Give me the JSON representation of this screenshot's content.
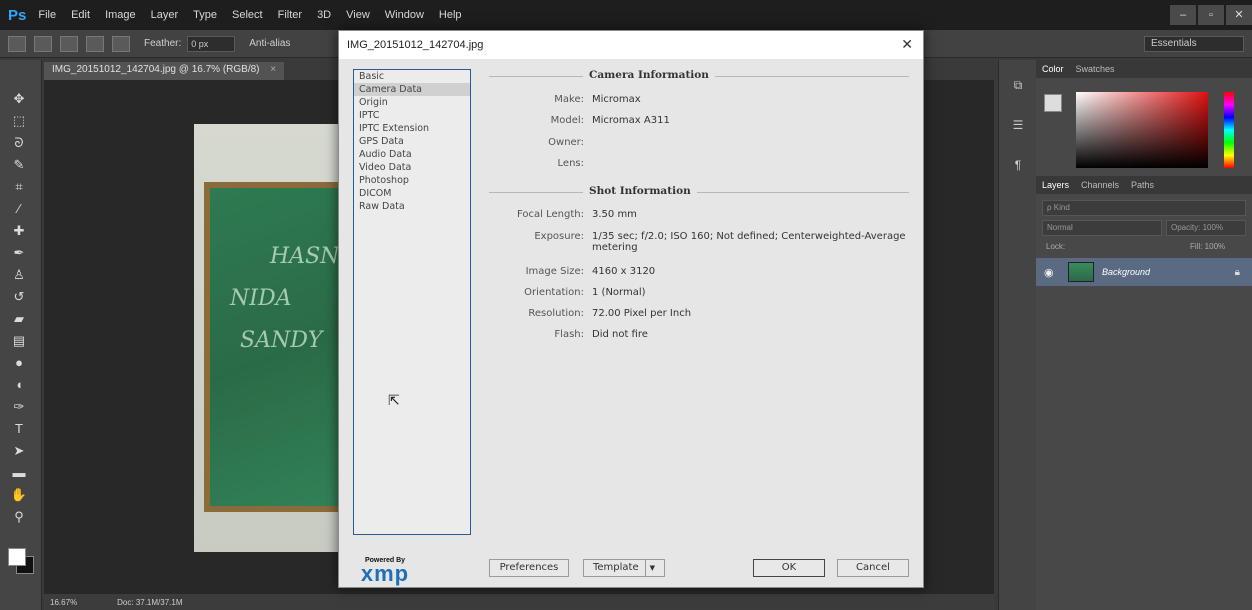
{
  "app": {
    "logo": "Ps",
    "menu": [
      "File",
      "Edit",
      "Image",
      "Layer",
      "Type",
      "Select",
      "Filter",
      "3D",
      "View",
      "Window",
      "Help"
    ],
    "window_controls": [
      "–",
      "▫",
      "✕"
    ]
  },
  "options_bar": {
    "feather_label": "Feather:",
    "feather_value": "0 px",
    "antialias_label": "Anti-alias",
    "workspace": "Essentials"
  },
  "document": {
    "tab_title": "IMG_20151012_142704.jpg @ 16.7% (RGB/8)",
    "tab_close": "×",
    "board_lines": [
      "HASN",
      "NIDA",
      "SANDY"
    ]
  },
  "status_bar": {
    "zoom": "16.67%",
    "doc_size": "Doc: 37.1M/37.1M"
  },
  "color_panel": {
    "tabs": [
      "Color",
      "Swatches"
    ]
  },
  "layers_panel": {
    "tabs": [
      "Layers",
      "Channels",
      "Paths"
    ],
    "kind_label": "ρ Kind",
    "blend_mode": "Normal",
    "opacity_label": "Opacity: 100%",
    "lock_label": "Lock:",
    "fill_label": "Fill: 100%",
    "layer_name": "Background"
  },
  "dialog": {
    "title": "IMG_20151012_142704.jpg",
    "close": "✕",
    "categories": [
      "Basic",
      "Camera Data",
      "Origin",
      "IPTC",
      "IPTC Extension",
      "GPS Data",
      "Audio Data",
      "Video Data",
      "Photoshop",
      "DICOM",
      "Raw Data"
    ],
    "selected_category": "Camera Data",
    "camera_section": "Camera Information",
    "camera_fields": [
      {
        "label": "Make:",
        "value": "Micromax"
      },
      {
        "label": "Model:",
        "value": "Micromax A311"
      },
      {
        "label": "Owner:",
        "value": ""
      },
      {
        "label": "Lens:",
        "value": ""
      }
    ],
    "shot_section": "Shot Information",
    "shot_fields": [
      {
        "label": "Focal Length:",
        "value": "3.50 mm"
      },
      {
        "label": "Exposure:",
        "value": "1/35 sec;  f/2.0;  ISO 160;  Not defined;  Centerweighted-Average metering"
      },
      {
        "label": "Image Size:",
        "value": "4160 x 3120"
      },
      {
        "label": "Orientation:",
        "value": "1 (Normal)"
      },
      {
        "label": "Resolution:",
        "value": "72.00 Pixel per Inch"
      },
      {
        "label": "Flash:",
        "value": "Did not fire"
      }
    ],
    "xmp_powered": "Powered By",
    "xmp_logo": "xmp",
    "buttons": {
      "preferences": "Preferences",
      "template": "Template",
      "ok": "OK",
      "cancel": "Cancel"
    }
  }
}
